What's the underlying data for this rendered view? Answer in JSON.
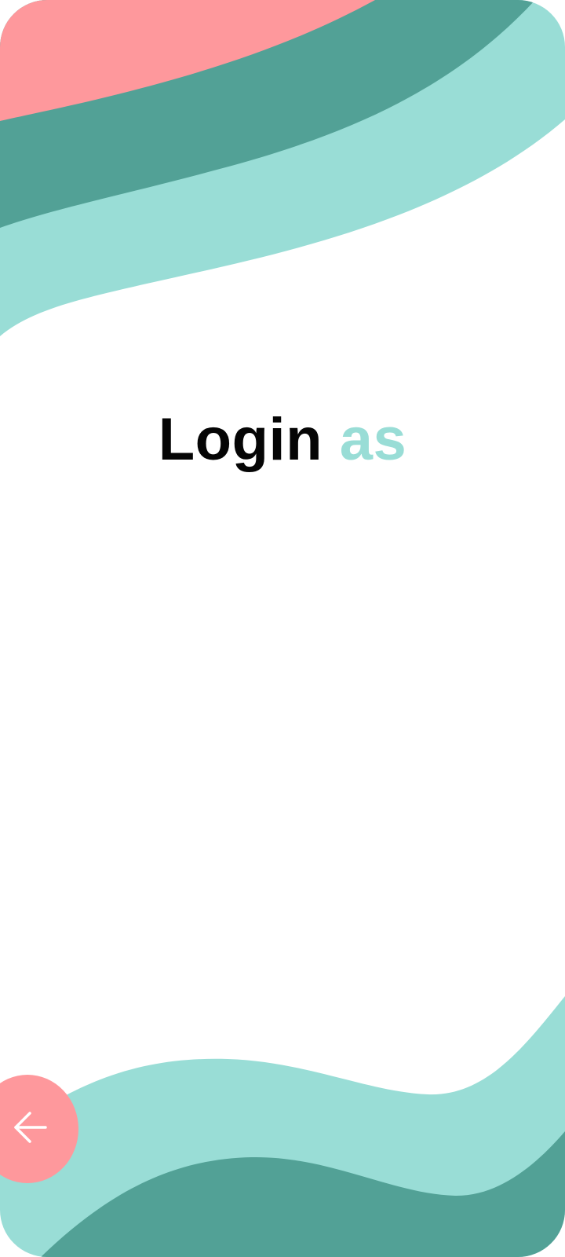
{
  "screen": {
    "title_main": "Login",
    "title_accent": "as"
  },
  "back_button": {
    "icon": "arrow-left-icon"
  },
  "colors": {
    "coral": "#fe989c",
    "teal_dark": "#52a196",
    "teal_light": "#99ddd6",
    "title_text": "#050505",
    "title_accent": "#99ddd6",
    "background": "#ffffff"
  }
}
